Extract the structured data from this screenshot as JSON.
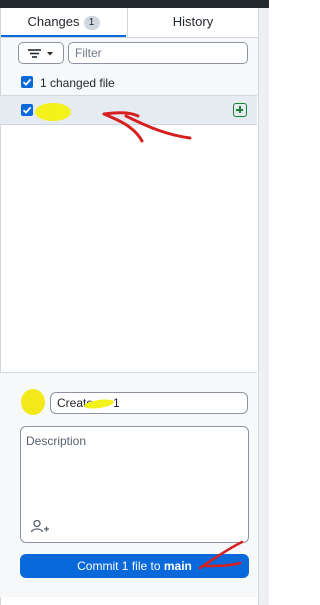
{
  "tabs": {
    "changes_label": "Changes",
    "changes_count": "1",
    "history_label": "History"
  },
  "filter": {
    "placeholder": "Filter"
  },
  "changes": {
    "summary_label": "1 changed file"
  },
  "commit": {
    "summary_value": "Create      1",
    "description_placeholder": "Description",
    "button_prefix": "Commit 1 file to",
    "branch": "main"
  },
  "colors": {
    "accent": "#0969da",
    "added": "#1a7f37",
    "highlight": "#f3f21a",
    "annotation": "#d61f1f"
  },
  "icons": [
    "filter-icon",
    "chevron-down-icon",
    "checkbox-icon",
    "file-added-icon",
    "add-coauthor-icon"
  ]
}
